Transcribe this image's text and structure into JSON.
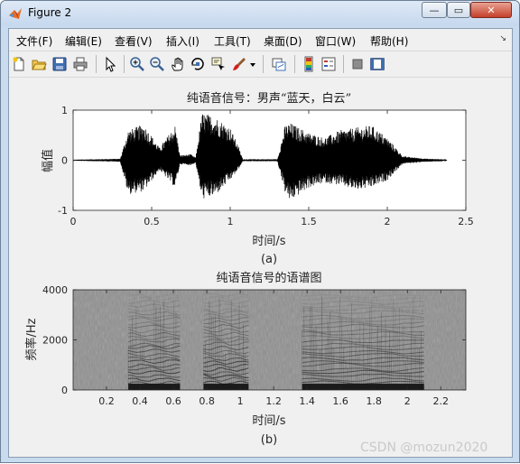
{
  "window": {
    "title": "Figure 2",
    "controls": {
      "minimize": "—",
      "maximize": "▭",
      "close": "✕"
    }
  },
  "menu": {
    "items": [
      "文件(F)",
      "编辑(E)",
      "查看(V)",
      "插入(I)",
      "工具(T)",
      "桌面(D)",
      "窗口(W)",
      "帮助(H)"
    ],
    "overflow": "↘"
  },
  "toolbar": {
    "icons": [
      "new-figure-icon",
      "open-file-icon",
      "save-icon",
      "print-icon",
      "pointer-icon",
      "zoom-in-icon",
      "zoom-out-icon",
      "pan-hand-icon",
      "rotate-3d-icon",
      "data-cursor-icon",
      "brush-icon",
      "brush-dropdown-icon",
      "link-plot-icon",
      "colorbar-icon",
      "legend-icon",
      "hide-plot-tools-icon",
      "show-plot-tools-icon"
    ]
  },
  "colors": {
    "background": "#f0f0f0",
    "axes_bg": "#ffffff",
    "waveform": "#000000",
    "spectrogram_bg": "#8f8f8f"
  },
  "chart_data": [
    {
      "type": "line",
      "title": "纯语音信号：男声“蓝天，白云”",
      "xlabel": "时间/s",
      "ylabel": "幅值",
      "caption": "(a)",
      "xlim": [
        0,
        2.5
      ],
      "ylim": [
        -1,
        1
      ],
      "xticks": [
        "0",
        "0.5",
        "1",
        "1.5",
        "2",
        "2.5"
      ],
      "yticks": [
        "-1",
        "0",
        "1"
      ],
      "grid": false,
      "series": [
        {
          "envelope": {
            "t": [
              0,
              0.3,
              0.35,
              0.45,
              0.55,
              0.65,
              0.68,
              0.75,
              0.78,
              0.82,
              0.9,
              1.0,
              1.05,
              1.08,
              1.3,
              1.35,
              1.38,
              1.5,
              1.6,
              1.7,
              1.8,
              1.9,
              2.0,
              2.1,
              2.25,
              2.35,
              2.38
            ],
            "pos": [
              0.01,
              0.03,
              0.6,
              0.72,
              0.25,
              0.7,
              0.1,
              0.12,
              0.05,
              0.95,
              0.88,
              0.65,
              0.3,
              0.02,
              0.02,
              0.7,
              0.75,
              0.55,
              0.45,
              0.6,
              0.65,
              0.7,
              0.45,
              0.08,
              0.03,
              0.02,
              0.0
            ],
            "neg": [
              0.01,
              0.03,
              0.68,
              0.62,
              0.2,
              0.55,
              0.08,
              0.1,
              0.05,
              0.78,
              0.72,
              0.4,
              0.2,
              0.02,
              0.02,
              0.65,
              0.82,
              0.55,
              0.45,
              0.5,
              0.6,
              0.55,
              0.4,
              0.07,
              0.03,
              0.02,
              0.0
            ]
          }
        }
      ]
    },
    {
      "type": "heatmap",
      "title": "纯语音信号的语谱图",
      "xlabel": "时间/s",
      "ylabel": "频率/Hz",
      "caption": "(b)",
      "xlim": [
        0,
        2.35
      ],
      "ylim": [
        0,
        4000
      ],
      "xticks": [
        "0.2",
        "0.4",
        "0.6",
        "0.8",
        "1",
        "1.2",
        "1.4",
        "1.6",
        "1.8",
        "2",
        "2.2"
      ],
      "yticks": [
        "0",
        "2000",
        "4000"
      ],
      "grid": false,
      "colormap": "gray",
      "voiced_segments": [
        {
          "t0": 0.33,
          "t1": 0.64
        },
        {
          "t0": 0.78,
          "t1": 1.05
        },
        {
          "t0": 1.37,
          "t1": 2.1
        }
      ]
    }
  ],
  "watermark": "CSDN @mozun2020"
}
